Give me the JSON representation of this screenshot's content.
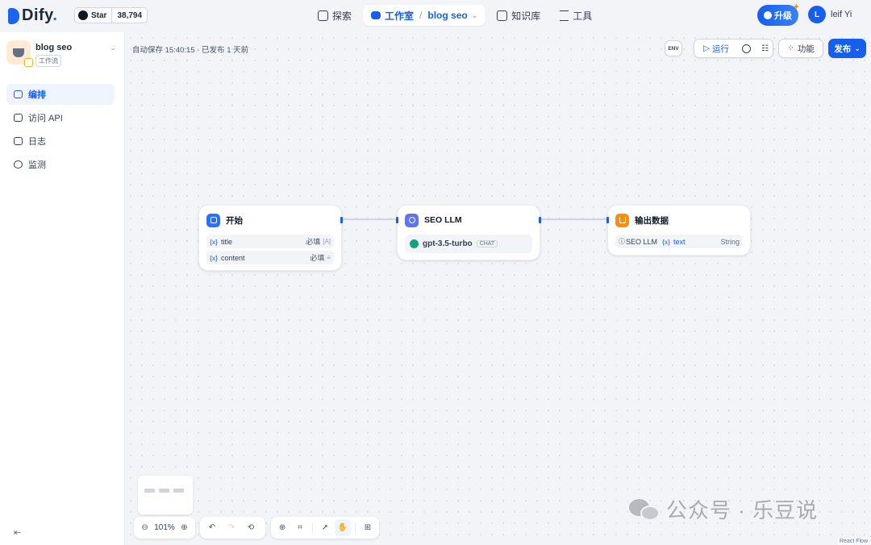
{
  "brand": {
    "name": "Dify",
    "suffix": "."
  },
  "github": {
    "label": "Star",
    "count": "38,794"
  },
  "nav": {
    "explore": "探索",
    "studio": "工作室",
    "app": "blog seo",
    "knowledge": "知识库",
    "tools": "工具"
  },
  "upgrade_label": "升级",
  "user": {
    "initial": "L",
    "name": "leif Yi"
  },
  "app": {
    "name": "blog seo",
    "type": "工作流"
  },
  "sidebar": {
    "items": [
      {
        "label": "编排",
        "icon": "layout-icon",
        "active": true
      },
      {
        "label": "访问 API",
        "icon": "terminal-icon",
        "active": false
      },
      {
        "label": "日志",
        "icon": "log-icon",
        "active": false
      },
      {
        "label": "监测",
        "icon": "monitor-icon",
        "active": false
      }
    ]
  },
  "autosave": "自动保存 15:40:15 · 已发布 1 天前",
  "toolbar": {
    "env": "ENV",
    "run": "运行",
    "features": "功能",
    "publish": "发布"
  },
  "nodes": {
    "start": {
      "title": "开始",
      "vars": [
        {
          "name": "title",
          "required": "必填",
          "type": "[A]"
        },
        {
          "name": "content",
          "required": "必填",
          "type": "≡"
        }
      ]
    },
    "llm": {
      "title": "SEO LLM",
      "model": "gpt-3.5-turbo",
      "mode": "CHAT"
    },
    "end": {
      "title": "输出数据",
      "source": "SEO LLM",
      "var": "text",
      "type": "String"
    }
  },
  "var_prefix": "{x}",
  "zoom": "101%",
  "react_flow": "React Flow",
  "watermark": "公众号 · 乐豆说",
  "colors": {
    "accent": "#155eef",
    "start": "#2970ff",
    "llm": "#6172f3",
    "end": "#f79009",
    "gpt": "#10a37f"
  }
}
